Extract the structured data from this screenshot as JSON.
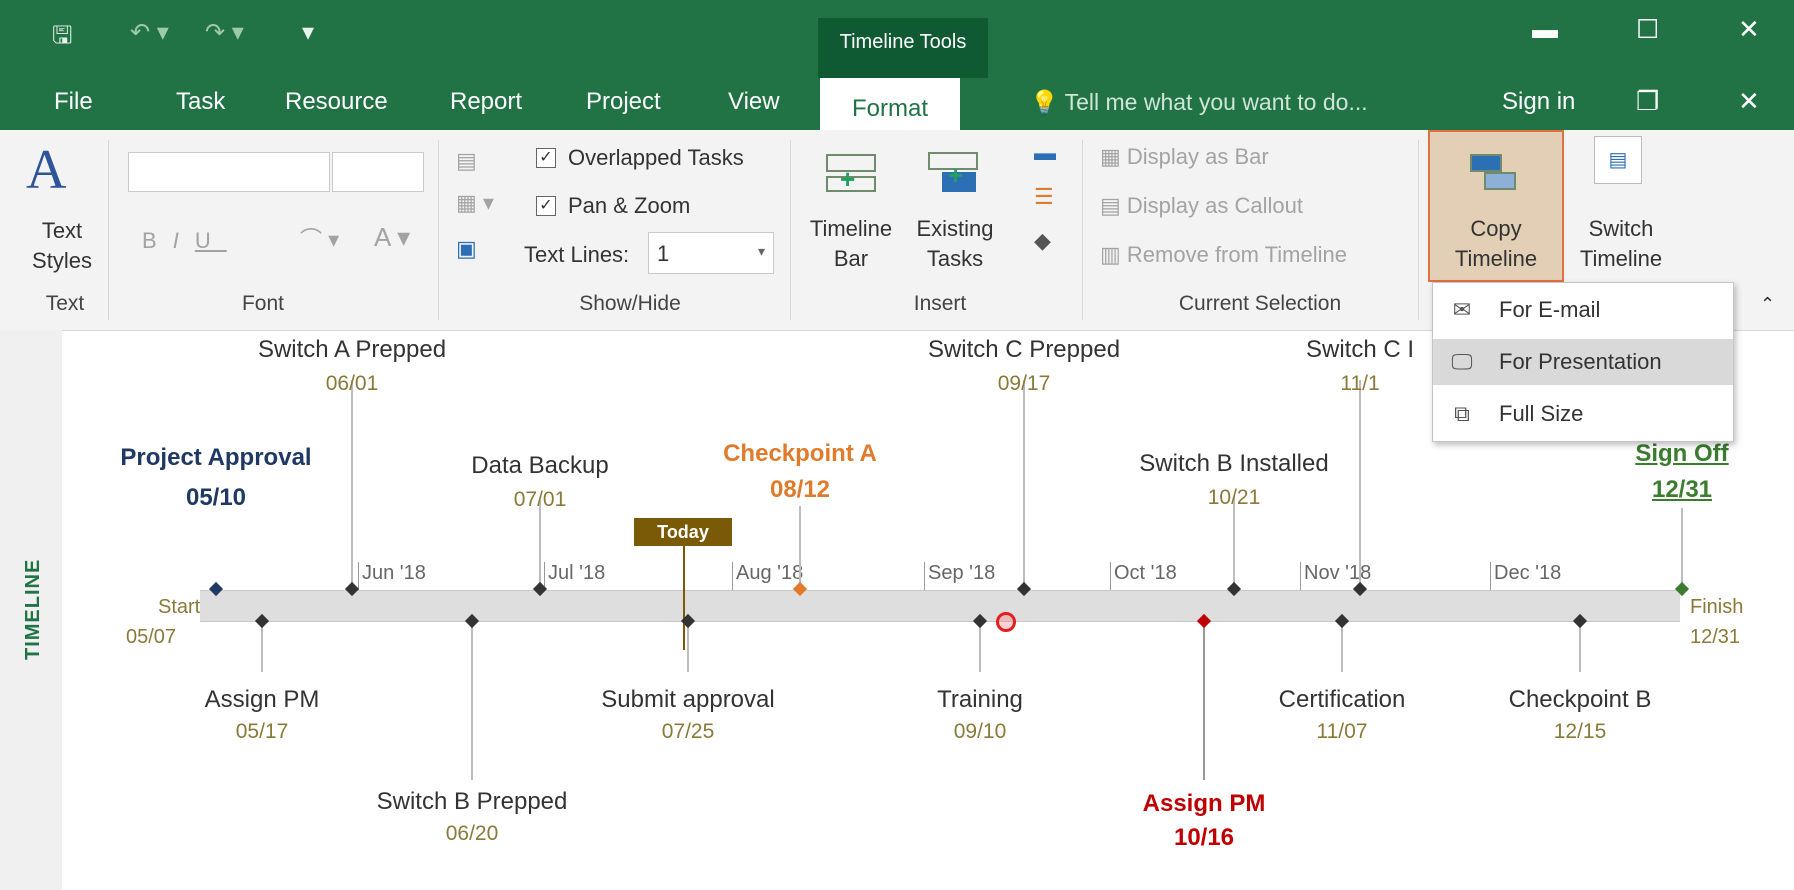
{
  "window": {
    "context_tab_group": "Timeline Tools",
    "icons": [
      "save-icon",
      "undo-icon",
      "redo-icon",
      "quick-access-customize-icon"
    ],
    "controls": [
      "minimize-icon",
      "restore-icon",
      "close-icon"
    ]
  },
  "tabs": [
    "File",
    "Task",
    "Resource",
    "Report",
    "Project",
    "View",
    "Format"
  ],
  "active_tab": "Format",
  "tell_me": "Tell me what you want to do...",
  "sign_in": "Sign in",
  "ribbon": {
    "text_group": {
      "button": "Text Styles",
      "label": "Text"
    },
    "font_group": {
      "label": "Font",
      "buttons": [
        "B",
        "I",
        "U",
        "A"
      ]
    },
    "show_hide_group": {
      "label": "Show/Hide",
      "overlapped_tasks": "Overlapped Tasks",
      "pan_zoom": "Pan & Zoom",
      "text_lines_label": "Text Lines:",
      "text_lines_value": "1"
    },
    "insert_group": {
      "label": "Insert",
      "timeline_bar": "Timeline Bar",
      "existing_tasks": "Existing Tasks"
    },
    "current_selection_group": {
      "label": "Current Selection",
      "display_as_bar": "Display as Bar",
      "display_as_callout": "Display as Callout",
      "remove_from_timeline": "Remove from Timeline"
    },
    "copy_timeline": "Copy Timeline",
    "switch_timeline": "Switch Timeline"
  },
  "copy_menu": {
    "items": [
      {
        "label": "For E-mail",
        "icon": "email-icon"
      },
      {
        "label": "For Presentation",
        "icon": "presentation-icon",
        "selected": true
      },
      {
        "label": "Full Size",
        "icon": "full-size-icon"
      }
    ]
  },
  "timeline": {
    "side_label": "TIMELINE",
    "today_label": "Today",
    "start": {
      "label": "Start",
      "date": "05/07"
    },
    "finish": {
      "label": "Finish",
      "date": "12/31"
    },
    "months": [
      "Jun '18",
      "Jul '18",
      "Aug '18",
      "Sep '18",
      "Oct '18",
      "Nov '18",
      "Dec '18"
    ],
    "above": [
      {
        "name": "Project Approval",
        "date": "05/10",
        "color": "#1f3864",
        "bold": true
      },
      {
        "name": "Switch A Prepped",
        "date": "06/01"
      },
      {
        "name": "Data Backup",
        "date": "07/01"
      },
      {
        "name": "Checkpoint A",
        "date": "08/12",
        "color": "#e07b2c",
        "bold": true
      },
      {
        "name": "Switch C Prepped",
        "date": "09/17"
      },
      {
        "name": "Switch B Installed",
        "date": "10/21"
      },
      {
        "name": "Switch C I",
        "date": "11/1"
      },
      {
        "name": "Sign Off",
        "date": "12/31",
        "color": "#3a7d2e",
        "bold": true
      }
    ],
    "below": [
      {
        "name": "Assign PM",
        "date": "05/17"
      },
      {
        "name": "Switch B Prepped",
        "date": "06/20"
      },
      {
        "name": "Submit approval",
        "date": "07/25"
      },
      {
        "name": "Training",
        "date": "09/10"
      },
      {
        "name": "Assign PM",
        "date": "10/16",
        "color": "#c00000",
        "bold": true
      },
      {
        "name": "Certification",
        "date": "11/07"
      },
      {
        "name": "Checkpoint B",
        "date": "12/15"
      }
    ]
  }
}
